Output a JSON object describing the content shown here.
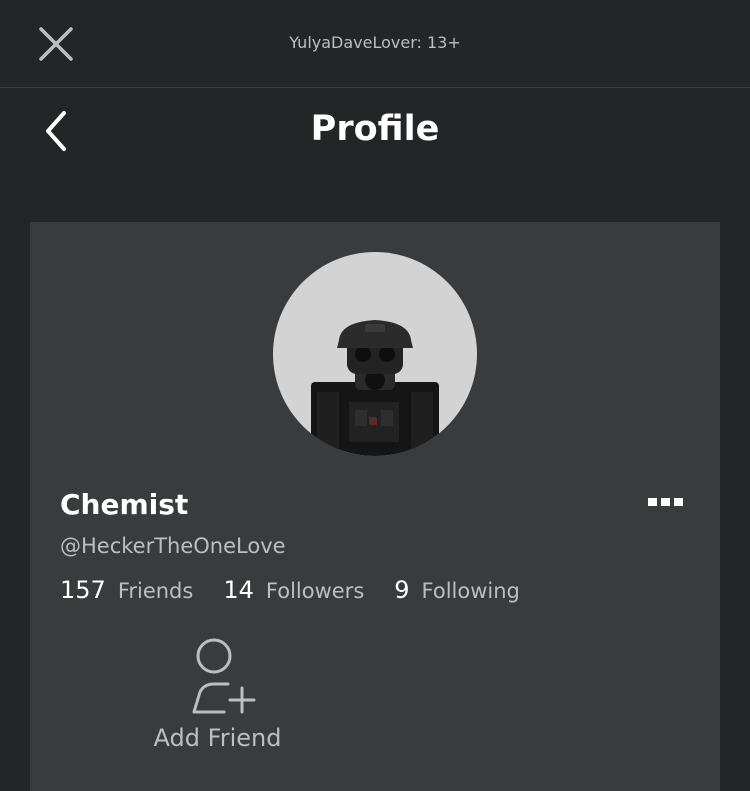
{
  "topbar": {
    "account_label": "YulyaDaveLover: 13+",
    "close_icon": "close-icon"
  },
  "header": {
    "title": "Profile",
    "back_icon": "chevron-left-icon"
  },
  "profile": {
    "display_name": "Chemist",
    "username": "@HeckerTheOneLove",
    "more_icon": "more-options-icon",
    "stats": {
      "friends": {
        "count": "157",
        "label": "Friends"
      },
      "followers": {
        "count": "14",
        "label": "Followers"
      },
      "following": {
        "count": "9",
        "label": "Following"
      }
    },
    "add_friend": {
      "label": "Add Friend",
      "icon": "add-friend-icon"
    }
  },
  "colors": {
    "background": "#232527",
    "card": "#393b3d",
    "text_primary": "#ffffff",
    "text_secondary": "#bdbebe",
    "avatar_bg": "#d3d3d3"
  }
}
